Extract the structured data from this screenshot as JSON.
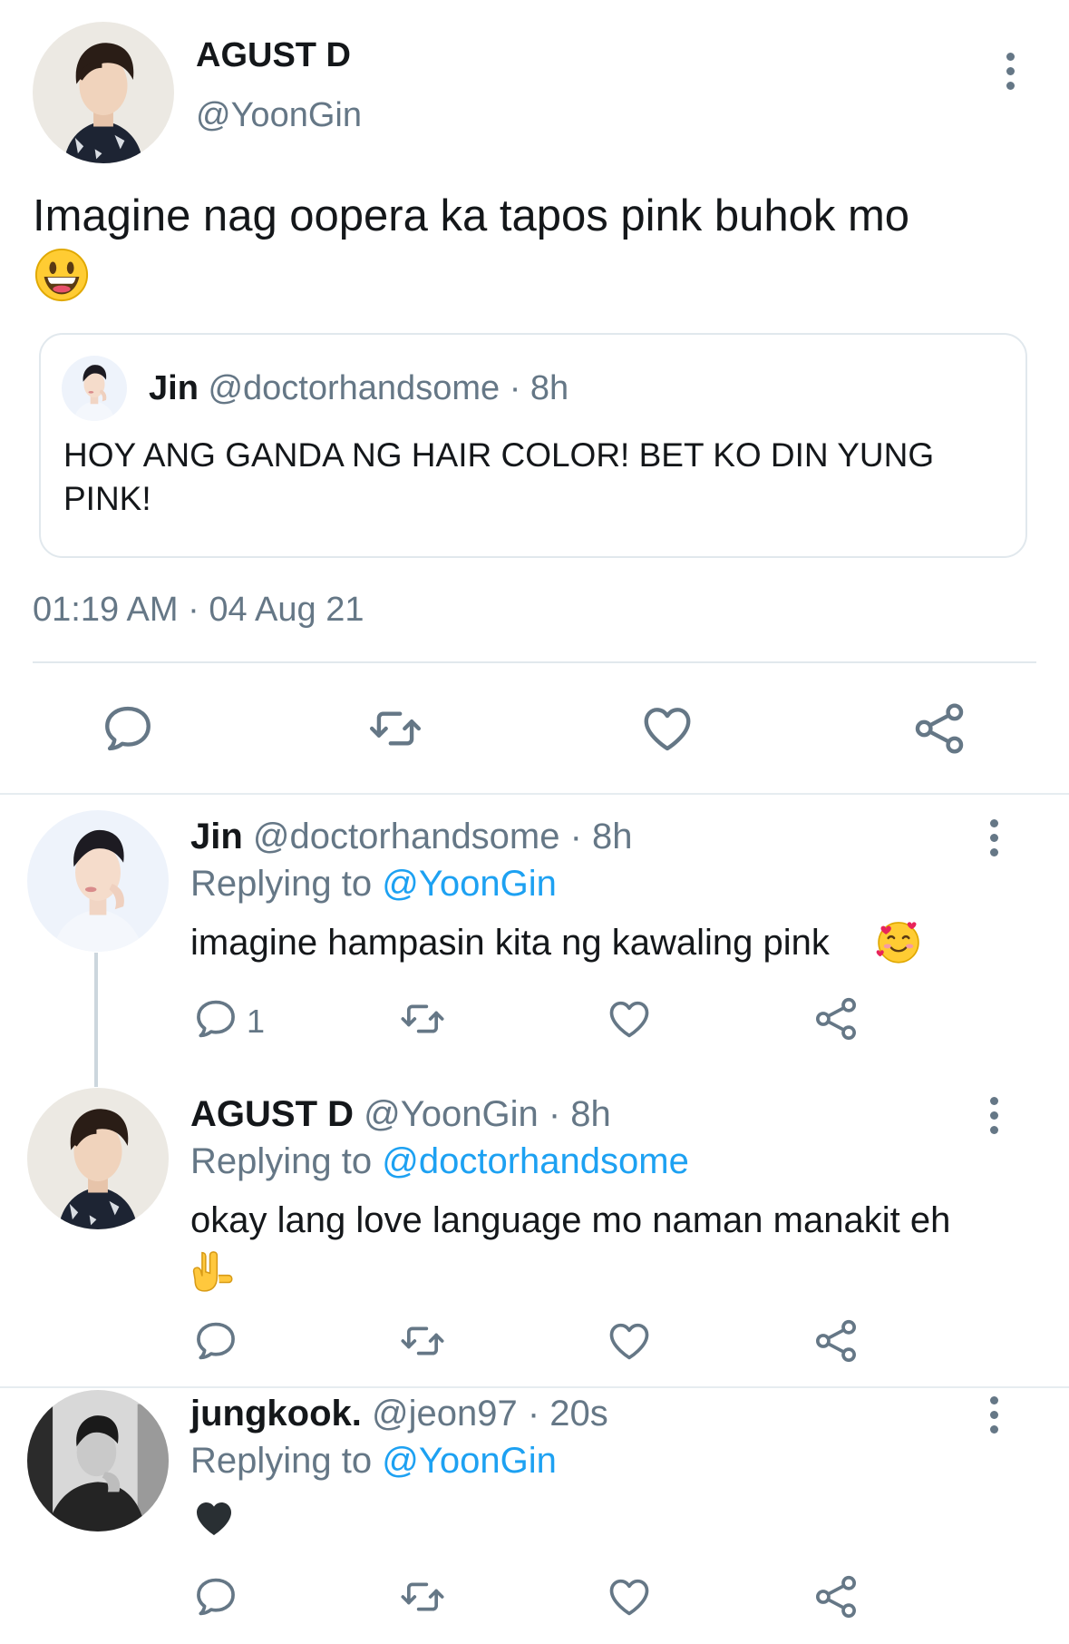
{
  "main_tweet": {
    "display_name": "AGUST D",
    "handle": "@YoonGin",
    "text": "Imagine nag oopera ka tapos pink buhok mo",
    "emoji": "grinning-face",
    "quoted": {
      "display_name": "Jin",
      "handle": "@doctorhandsome",
      "time": "· 8h",
      "text": "HOY ANG GANDA NG HAIR COLOR! BET KO DIN YUNG PINK!"
    },
    "timestamp": "01:19 AM · 04 Aug 21",
    "actions": [
      "reply-icon",
      "retweet-icon",
      "like-icon",
      "share-icon"
    ]
  },
  "replies": [
    {
      "display_name": "Jin",
      "handle": "@doctorhandsome",
      "time": "· 8h",
      "replying_prefix": "Replying to",
      "replying_to": "@YoonGin",
      "text": "imagine hampasin kita ng kawaling pink",
      "emoji": "smiling-face-with-hearts",
      "reply_count": "1"
    },
    {
      "display_name": "AGUST D",
      "handle": "@YoonGin",
      "time": "· 8h",
      "replying_prefix": "Replying to",
      "replying_to": "@doctorhandsome",
      "text": "okay lang love language mo naman manakit eh",
      "emoji": "love-you-gesture"
    },
    {
      "display_name": "jungkook.",
      "handle": "@jeon97",
      "time": "· 20s",
      "replying_prefix": "Replying to",
      "replying_to": "@YoonGin",
      "emoji": "black-heart"
    }
  ],
  "colors": {
    "link": "#1da1f2",
    "secondary": "#657786",
    "divider": "#e1e8ed"
  }
}
